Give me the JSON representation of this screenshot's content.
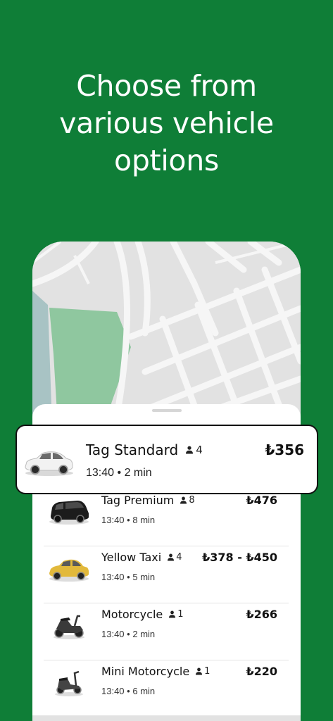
{
  "headline": {
    "line1": "Choose from",
    "line2": "various vehicle",
    "line3": "options"
  },
  "selected_option": {
    "name": "Tag Standard",
    "capacity": "4",
    "price": "₺356",
    "time": "13:40",
    "eta": "2 min",
    "separator": "•",
    "vehicle_icon": "white-sedan-icon"
  },
  "options": [
    {
      "name": "Tag Premium",
      "capacity": "8",
      "price": "₺476",
      "time": "13:40",
      "eta": "8 min",
      "vehicle_icon": "black-minivan-icon"
    },
    {
      "name": "Yellow Taxi",
      "capacity": "4",
      "price": "₺378 - ₺450",
      "time": "13:40",
      "eta": "5 min",
      "vehicle_icon": "yellow-taxi-icon"
    },
    {
      "name": "Motorcycle",
      "capacity": "1",
      "price": "₺266",
      "time": "13:40",
      "eta": "2 min",
      "vehicle_icon": "motorcycle-icon"
    },
    {
      "name": "Mini Motorcycle",
      "capacity": "1",
      "price": "₺220",
      "time": "13:40",
      "eta": "6 min",
      "vehicle_icon": "scooter-icon"
    }
  ],
  "colors": {
    "background": "#0f7e37",
    "map_park": "#8fc79f",
    "map_water": "#a8c3c4"
  }
}
